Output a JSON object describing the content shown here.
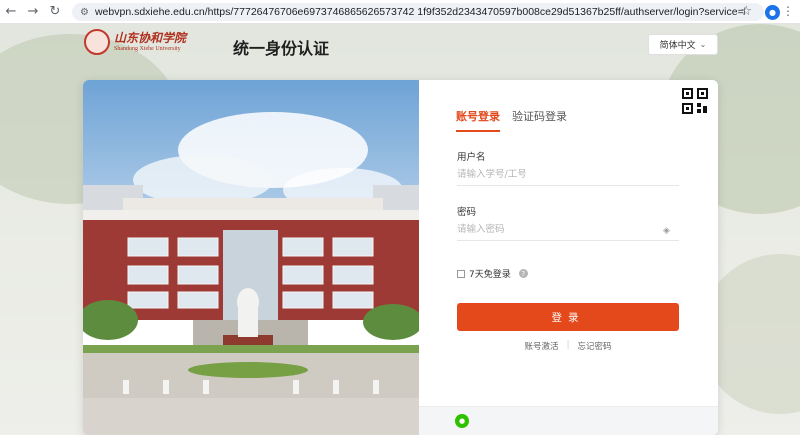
{
  "browser": {
    "url": "webvpn.sdxiehe.edu.cn/https/77726476706e6973746865626573742 1f9f352d2343470597b008ce29d51367b25ff/authserver/login?service=https%3..."
  },
  "header": {
    "logo_cn": "山东协和学院",
    "logo_en": "Shandong Xiehe University",
    "seal_char": "協",
    "title": "统一身份认证",
    "language": "简体中文"
  },
  "login": {
    "tabs": [
      {
        "label": "账号登录",
        "active": true
      },
      {
        "label": "验证码登录",
        "active": false
      }
    ],
    "username_label": "用户名",
    "username_placeholder": "请输入学号/工号",
    "password_label": "密码",
    "password_placeholder": "请输入密码",
    "remember_label": "7天免登录",
    "submit_label": "登录",
    "activate_link": "账号激活",
    "forgot_link": "忘记密码"
  },
  "colors": {
    "accent": "#e4491c",
    "wechat": "#2dc100"
  }
}
